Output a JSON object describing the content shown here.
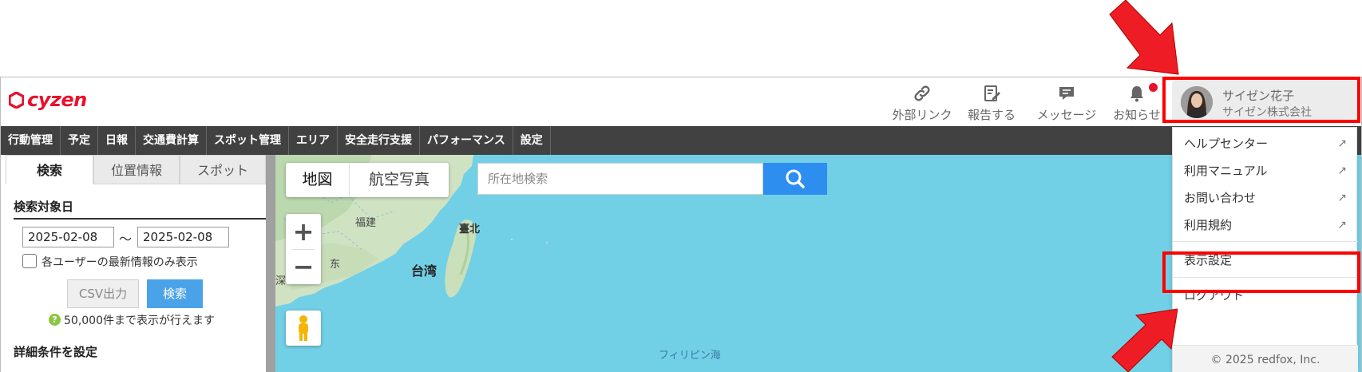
{
  "app": {
    "logo_text": "cyzen"
  },
  "header": {
    "items": [
      {
        "label": "外部リンク",
        "icon": "link-icon"
      },
      {
        "label": "報告する",
        "icon": "report-edit-icon"
      },
      {
        "label": "メッセージ",
        "icon": "message-icon"
      },
      {
        "label": "お知らせ",
        "icon": "bell-icon",
        "has_badge": true
      }
    ],
    "user": {
      "name": "サイゼン花子",
      "company": "サイゼン株式会社"
    }
  },
  "nav": {
    "items": [
      "行動管理",
      "予定",
      "日報",
      "交通費計算",
      "スポット管理",
      "エリア",
      "安全走行支援",
      "パフォーマンス",
      "設定"
    ]
  },
  "sidebar": {
    "tabs": [
      "検索",
      "位置情報",
      "スポット"
    ],
    "active_tab": "検索",
    "search_date_title": "検索対象日",
    "date_from": "2025-02-08",
    "date_to": "2025-02-08",
    "date_separator": "〜",
    "latest_only_label": "各ユーザーの最新情報のみ表示",
    "latest_only_checked": false,
    "csv_button": "CSV出力",
    "search_button": "検索",
    "help_text": "50,000件まで表示が行えます",
    "detail_title": "詳細条件を設定"
  },
  "map": {
    "type_buttons": [
      "地図",
      "航空写真"
    ],
    "search_placeholder": "所在地検索",
    "labels": {
      "taipei": "臺北",
      "taiwan": "台湾",
      "fujian": "福建",
      "guangdong_partial": "东",
      "shenzhen_partial": "深",
      "philippine_sea": "フィリピン海"
    },
    "zoom_in": "+",
    "zoom_out": "−"
  },
  "user_menu": {
    "items": [
      {
        "label": "ヘルプセンター",
        "external": true
      },
      {
        "label": "利用マニュアル",
        "external": true
      },
      {
        "label": "お問い合わせ",
        "external": true
      },
      {
        "label": "利用規約",
        "external": true
      },
      {
        "label": "表示設定",
        "external": false
      },
      {
        "label": "ログアウト",
        "external": false
      }
    ],
    "external_mark": "↗",
    "copyright": "© 2025 redfox, Inc."
  },
  "colors": {
    "brand": "#e8112d",
    "nav_bg": "#414141",
    "search_button": "#4aa3e8",
    "map_search_button": "#2d8ef0",
    "annotation": "#ff0000",
    "sea": "#72d0e6"
  }
}
